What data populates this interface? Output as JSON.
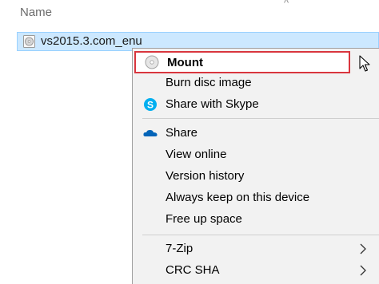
{
  "explorer": {
    "column_header": "Name",
    "selected_file": "vs2015.3.com_enu"
  },
  "context_menu": {
    "items": [
      {
        "label": "Mount",
        "icon": "disc-icon",
        "highlighted": true
      },
      {
        "label": "Burn disc image"
      },
      {
        "label": "Share with Skype",
        "icon": "skype-icon"
      },
      {
        "label": "Share",
        "icon": "onedrive-cloud-icon"
      },
      {
        "label": "View online"
      },
      {
        "label": "Version history"
      },
      {
        "label": "Always keep on this device"
      },
      {
        "label": "Free up space"
      },
      {
        "label": "7-Zip",
        "submenu": true
      },
      {
        "label": "CRC SHA",
        "submenu": true
      }
    ]
  },
  "colors": {
    "selection_fill": "#cce8ff",
    "highlight_border": "#d9363e",
    "skype_blue": "#00aff0",
    "onedrive_blue": "#0364b8"
  }
}
